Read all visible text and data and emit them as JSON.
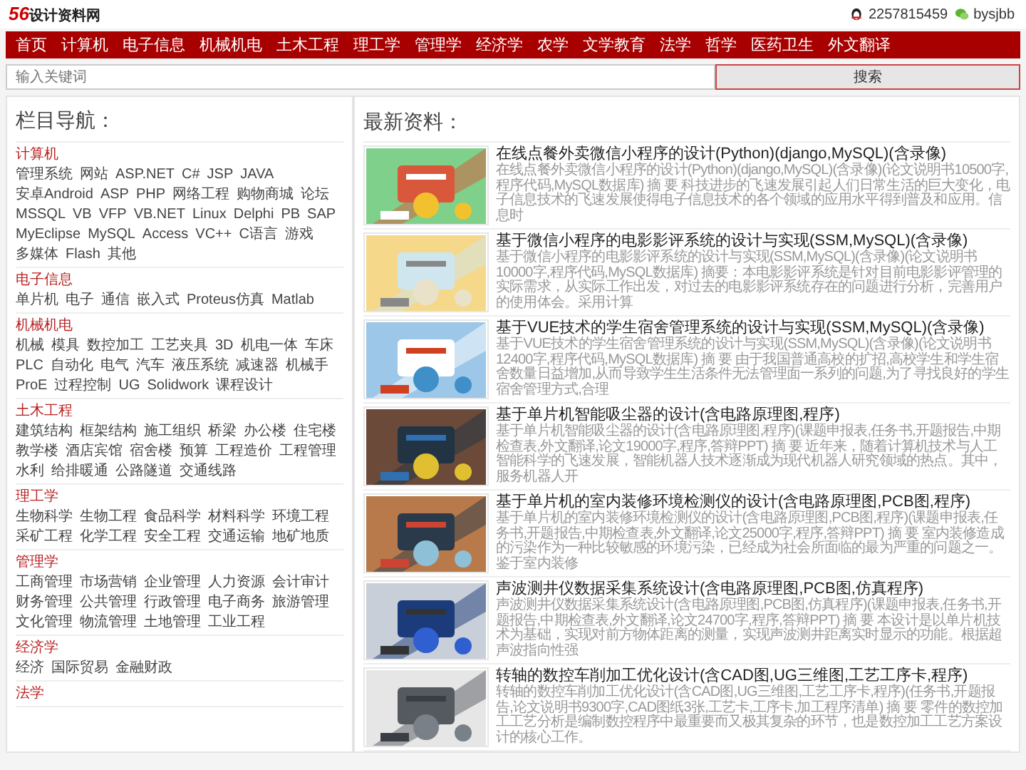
{
  "header": {
    "logo_number": "56",
    "logo_text": "设计资料网",
    "qq": "2257815459",
    "wechat": "bysjbb"
  },
  "nav": [
    "首页",
    "计算机",
    "电子信息",
    "机械机电",
    "土木工程",
    "理工学",
    "管理学",
    "经济学",
    "农学",
    "文学教育",
    "法学",
    "哲学",
    "医药卫生",
    "外文翻译"
  ],
  "search": {
    "placeholder": "输入关键词",
    "button": "搜索"
  },
  "sidebar": {
    "title": "栏目导航：",
    "sections": [
      {
        "heading": "计算机",
        "links": [
          "管理系统",
          "网站",
          "ASP.NET",
          "C#",
          "JSP",
          "JAVA",
          "安卓Android",
          "ASP",
          "PHP",
          "网络工程",
          "购物商城",
          "论坛",
          "MSSQL",
          "VB",
          "VFP",
          "VB.NET",
          "Linux",
          "Delphi",
          "PB",
          "SAP",
          "MyEclipse",
          "MySQL",
          "Access",
          "VC++",
          "C语言",
          "游戏",
          "多媒体",
          "Flash",
          "其他"
        ]
      },
      {
        "heading": "电子信息",
        "links": [
          "单片机",
          "电子",
          "通信",
          "嵌入式",
          "Proteus仿真",
          "Matlab"
        ]
      },
      {
        "heading": "机械机电",
        "links": [
          "机械",
          "模具",
          "数控加工",
          "工艺夹具",
          "3D",
          "机电一体",
          "车床",
          "PLC",
          "自动化",
          "电气",
          "汽车",
          "液压系统",
          "减速器",
          "机械手",
          "ProE",
          "过程控制",
          "UG",
          "Solidwork",
          "课程设计"
        ]
      },
      {
        "heading": "土木工程",
        "links": [
          "建筑结构",
          "框架结构",
          "施工组织",
          "桥梁",
          "办公楼",
          "住宅楼",
          "教学楼",
          "酒店宾馆",
          "宿舍楼",
          "预算",
          "工程造价",
          "工程管理",
          "水利",
          "给排暖通",
          "公路隧道",
          "交通线路"
        ]
      },
      {
        "heading": "理工学",
        "links": [
          "生物科学",
          "生物工程",
          "食品科学",
          "材料科学",
          "环境工程",
          "采矿工程",
          "化学工程",
          "安全工程",
          "交通运输",
          "地矿地质"
        ]
      },
      {
        "heading": "管理学",
        "links": [
          "工商管理",
          "市场营销",
          "企业管理",
          "人力资源",
          "会计审计",
          "财务管理",
          "公共管理",
          "行政管理",
          "电子商务",
          "旅游管理",
          "文化管理",
          "物流管理",
          "土地管理",
          "工业工程"
        ]
      },
      {
        "heading": "经济学",
        "links": [
          "经济",
          "国际贸易",
          "金融财政"
        ]
      },
      {
        "heading": "法学"
      }
    ]
  },
  "latest": {
    "title": "最新资料：",
    "items": [
      {
        "title": "在线点餐外卖微信小程序的设计(Python)(django,MySQL)(含录像)",
        "summary": "在线点餐外卖微信小程序的设计(Python)(django,MySQL)(含录像)(论文说明书10500字,程序代码,MySQL数据库) 摘 要 科技进步的飞速发展引起人们日常生活的巨大变化，电子信息技术的飞速发展使得电子信息技术的各个领域的应用水平得到普及和应用。信息时"
      },
      {
        "title": "基于微信小程序的电影影评系统的设计与实现(SSM,MySQL)(含录像)",
        "summary": "基于微信小程序的电影影评系统的设计与实现(SSM,MySQL)(含录像)(论文说明书10000字,程序代码,MySQL数据库) 摘要：本电影影评系统是针对目前电影影评管理的实际需求，从实际工作出发，对过去的电影影评系统存在的问题进行分析，完善用户的使用体会。采用计算"
      },
      {
        "title": "基于VUE技术的学生宿舍管理系统的设计与实现(SSM,MySQL)(含录像)",
        "summary": "基于VUE技术的学生宿舍管理系统的设计与实现(SSM,MySQL)(含录像)(论文说明书12400字,程序代码,MySQL数据库) 摘 要 由于我国普通高校的扩招,高校学生和学生宿舍数量日益增加,从而导致学生生活条件无法管理面一系列的问题,为了寻找良好的学生宿舍管理方式,合理"
      },
      {
        "title": "基于单片机智能吸尘器的设计(含电路原理图,程序)",
        "summary": "基于单片机智能吸尘器的设计(含电路原理图,程序)(课题申报表,任务书,开题报告,中期检查表,外文翻译,论文19000字,程序,答辩PPT) 摘 要 近年来，随着计算机技术与人工智能科学的飞速发展，智能机器人技术逐渐成为现代机器人研究领域的热点。其中，服务机器人开"
      },
      {
        "title": "基于单片机的室内装修环境检测仪的设计(含电路原理图,PCB图,程序)",
        "summary": "基于单片机的室内装修环境检测仪的设计(含电路原理图,PCB图,程序)(课题申报表,任务书,开题报告,中期检查表,外文翻译,论文25000字,程序,答辩PPT) 摘 要 室内装修造成的污染作为一种比较敏感的环境污染，已经成为社会所面临的最为严重的问题之一。鉴于室内装修"
      },
      {
        "title": "声波测井仪数据采集系统设计(含电路原理图,PCB图,仿真程序)",
        "summary": "声波测井仪数据采集系统设计(含电路原理图,PCB图,仿真程序)(课题申报表,任务书,开题报告,中期检查表,外文翻译,论文24700字,程序,答辩PPT) 摘 要 本设计是以单片机技术为基础，实现对前方物体距离的测量，实现声波测井距离实时显示的功能。根据超声波指向性强"
      },
      {
        "title": "转轴的数控车削加工优化设计(含CAD图,UG三维图,工艺工序卡,程序)",
        "summary": "转轴的数控车削加工优化设计(含CAD图,UG三维图,工艺工序卡,程序)(任务书,开题报告,论文说明书9300字,CAD图纸3张,工艺卡,工序卡,加工程序清单) 摘 要 零件的数控加工工艺分析是编制数控程序中最重要而又极其复杂的环节，也是数控加工工艺方案设计的核心工作。"
      }
    ]
  }
}
